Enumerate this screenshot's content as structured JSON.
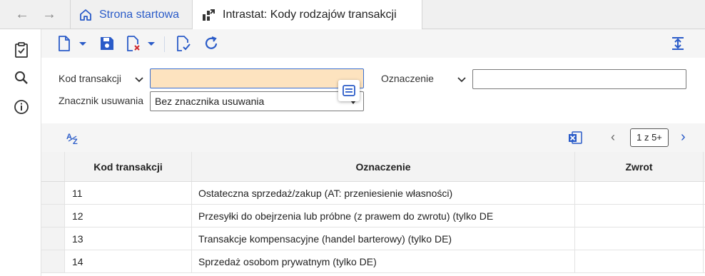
{
  "tabs": {
    "home_label": "Strona startowa",
    "active_label": "Intrastat: Kody rodzajów transakcji"
  },
  "filters": {
    "kod_label": "Kod transakcji",
    "kod_value": "",
    "oznaczenie_label": "Oznaczenie",
    "oznaczenie_value": "",
    "znacznik_label": "Znacznik usuwania",
    "znacznik_value": "Bez znacznika usuwania"
  },
  "grid": {
    "pager": "1 z 5+",
    "columns": [
      "Kod transakcji",
      "Oznaczenie",
      "Zwrot"
    ],
    "rows": [
      {
        "kod": "11",
        "oznaczenie": "Ostateczna sprzedaż/zakup (AT: przeniesienie własności)",
        "zwrot": ""
      },
      {
        "kod": "12",
        "oznaczenie": "Przesyłki do obejrzenia lub próbne (z prawem do zwrotu) (tylko DE",
        "zwrot": ""
      },
      {
        "kod": "13",
        "oznaczenie": "Transakcje kompensacyjne (handel barterowy) (tylko DE)",
        "zwrot": ""
      },
      {
        "kod": "14",
        "oznaczenie": "Sprzedaż osobom prywatnym (tylko DE)",
        "zwrot": ""
      }
    ]
  },
  "colors": {
    "accent": "#2a5bc8",
    "active_input": "#fde3bf",
    "excel_green": "#1d6f42"
  }
}
